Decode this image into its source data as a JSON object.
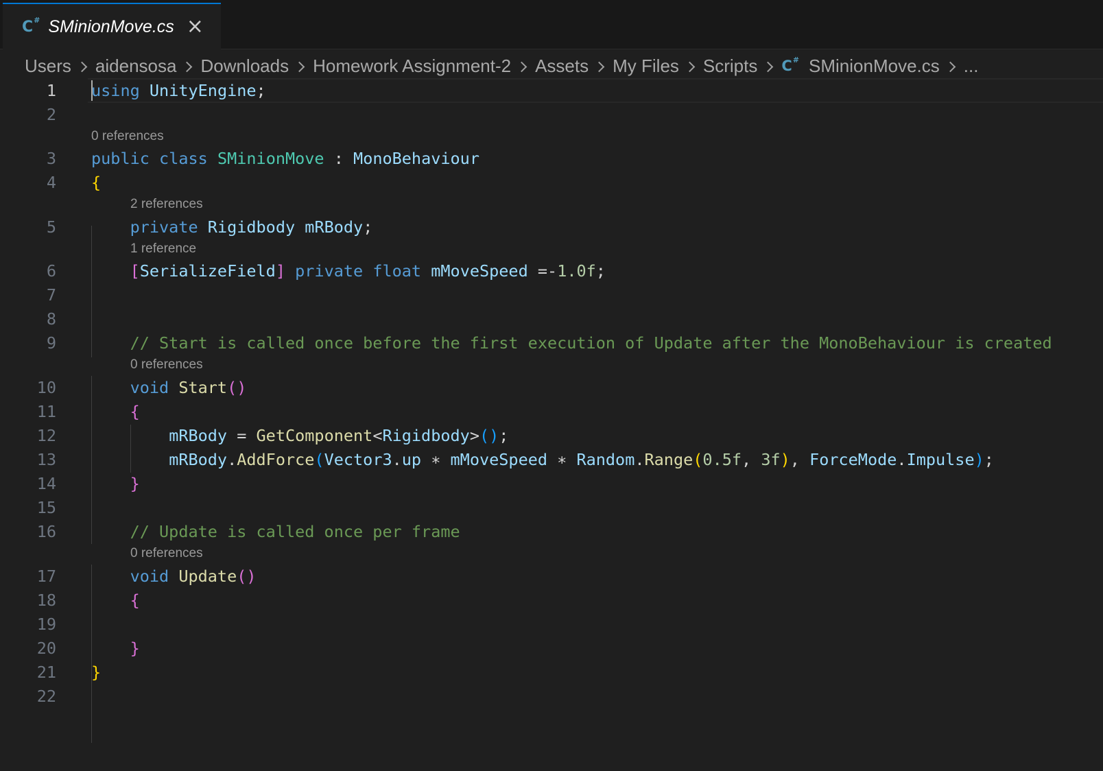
{
  "tab": {
    "icon": "csharp-file-icon",
    "name": "SMinionMove.cs",
    "close_glyph": "×"
  },
  "breadcrumb": {
    "items": [
      "Users",
      "aidensosa",
      "Downloads",
      "Homework Assignment-2",
      "Assets",
      "My Files",
      "Scripts"
    ],
    "file": "SMinionMove.cs",
    "more": "..."
  },
  "editor": {
    "active_line": 1,
    "code_lens": {
      "line3": "0 references",
      "line5": "2 references",
      "line6": "1 reference",
      "line10": "0 references",
      "line17": "0 references"
    },
    "lines": [
      {
        "number": "1",
        "tokens": [
          {
            "t": "using",
            "c": "kw"
          },
          {
            "t": " ",
            "c": "pl"
          },
          {
            "t": "UnityEngine",
            "c": "vr"
          },
          {
            "t": ";",
            "c": "pl"
          }
        ]
      },
      {
        "number": "2",
        "tokens": []
      },
      {
        "number": "3",
        "tokens": [
          {
            "t": "public",
            "c": "kw"
          },
          {
            "t": " ",
            "c": "pl"
          },
          {
            "t": "class",
            "c": "kw"
          },
          {
            "t": " ",
            "c": "pl"
          },
          {
            "t": "SMinionMove",
            "c": "ty"
          },
          {
            "t": " : ",
            "c": "pl"
          },
          {
            "t": "MonoBehaviour",
            "c": "vr"
          }
        ]
      },
      {
        "number": "4",
        "tokens": [
          {
            "t": "{",
            "c": "b1"
          }
        ]
      },
      {
        "number": "5",
        "tokens": [
          {
            "t": "    ",
            "c": "pl"
          },
          {
            "t": "private",
            "c": "kw"
          },
          {
            "t": " ",
            "c": "pl"
          },
          {
            "t": "Rigidbody",
            "c": "vr"
          },
          {
            "t": " ",
            "c": "pl"
          },
          {
            "t": "mRBody",
            "c": "vr"
          },
          {
            "t": ";",
            "c": "pl"
          }
        ]
      },
      {
        "number": "6",
        "tokens": [
          {
            "t": "    ",
            "c": "pl"
          },
          {
            "t": "[",
            "c": "b2"
          },
          {
            "t": "SerializeField",
            "c": "vr"
          },
          {
            "t": "]",
            "c": "b2"
          },
          {
            "t": " ",
            "c": "pl"
          },
          {
            "t": "private",
            "c": "kw"
          },
          {
            "t": " ",
            "c": "pl"
          },
          {
            "t": "float",
            "c": "kw"
          },
          {
            "t": " ",
            "c": "pl"
          },
          {
            "t": "mMoveSpeed",
            "c": "vr"
          },
          {
            "t": " =-",
            "c": "pl"
          },
          {
            "t": "1.0f",
            "c": "nm"
          },
          {
            "t": ";",
            "c": "pl"
          }
        ]
      },
      {
        "number": "7",
        "tokens": []
      },
      {
        "number": "8",
        "tokens": []
      },
      {
        "number": "9",
        "tokens": [
          {
            "t": "    ",
            "c": "pl"
          },
          {
            "t": "// Start is called once before the first execution of Update after the MonoBehaviour is created",
            "c": "cm"
          }
        ]
      },
      {
        "number": "10",
        "tokens": [
          {
            "t": "    ",
            "c": "pl"
          },
          {
            "t": "void",
            "c": "kw"
          },
          {
            "t": " ",
            "c": "pl"
          },
          {
            "t": "Start",
            "c": "fn"
          },
          {
            "t": "()",
            "c": "b2"
          }
        ]
      },
      {
        "number": "11",
        "tokens": [
          {
            "t": "    ",
            "c": "pl"
          },
          {
            "t": "{",
            "c": "b2"
          }
        ]
      },
      {
        "number": "12",
        "tokens": [
          {
            "t": "        ",
            "c": "pl"
          },
          {
            "t": "mRBody",
            "c": "vr"
          },
          {
            "t": " = ",
            "c": "pl"
          },
          {
            "t": "GetComponent",
            "c": "fn"
          },
          {
            "t": "<",
            "c": "pl"
          },
          {
            "t": "Rigidbody",
            "c": "vr"
          },
          {
            "t": ">",
            "c": "pl"
          },
          {
            "t": "()",
            "c": "b3"
          },
          {
            "t": ";",
            "c": "pl"
          }
        ]
      },
      {
        "number": "13",
        "tokens": [
          {
            "t": "        ",
            "c": "pl"
          },
          {
            "t": "mRBody",
            "c": "vr"
          },
          {
            "t": ".",
            "c": "pl"
          },
          {
            "t": "AddForce",
            "c": "fn"
          },
          {
            "t": "(",
            "c": "b3"
          },
          {
            "t": "Vector3",
            "c": "vr"
          },
          {
            "t": ".",
            "c": "pl"
          },
          {
            "t": "up",
            "c": "vr"
          },
          {
            "t": " ∗ ",
            "c": "pl"
          },
          {
            "t": "mMoveSpeed",
            "c": "vr"
          },
          {
            "t": " ∗ ",
            "c": "pl"
          },
          {
            "t": "Random",
            "c": "vr"
          },
          {
            "t": ".",
            "c": "pl"
          },
          {
            "t": "Range",
            "c": "fn"
          },
          {
            "t": "(",
            "c": "b1"
          },
          {
            "t": "0.5f",
            "c": "nm"
          },
          {
            "t": ", ",
            "c": "pl"
          },
          {
            "t": "3f",
            "c": "nm"
          },
          {
            "t": ")",
            "c": "b1"
          },
          {
            "t": ", ",
            "c": "pl"
          },
          {
            "t": "ForceMode",
            "c": "vr"
          },
          {
            "t": ".",
            "c": "pl"
          },
          {
            "t": "Impulse",
            "c": "vr"
          },
          {
            "t": ")",
            "c": "b3"
          },
          {
            "t": ";",
            "c": "pl"
          }
        ]
      },
      {
        "number": "14",
        "tokens": [
          {
            "t": "    ",
            "c": "pl"
          },
          {
            "t": "}",
            "c": "b2"
          }
        ]
      },
      {
        "number": "15",
        "tokens": []
      },
      {
        "number": "16",
        "tokens": [
          {
            "t": "    ",
            "c": "pl"
          },
          {
            "t": "// Update is called once per frame",
            "c": "cm"
          }
        ]
      },
      {
        "number": "17",
        "tokens": [
          {
            "t": "    ",
            "c": "pl"
          },
          {
            "t": "void",
            "c": "kw"
          },
          {
            "t": " ",
            "c": "pl"
          },
          {
            "t": "Update",
            "c": "fn"
          },
          {
            "t": "()",
            "c": "b2"
          }
        ]
      },
      {
        "number": "18",
        "tokens": [
          {
            "t": "    ",
            "c": "pl"
          },
          {
            "t": "{",
            "c": "b2"
          }
        ]
      },
      {
        "number": "19",
        "tokens": []
      },
      {
        "number": "20",
        "tokens": [
          {
            "t": "    ",
            "c": "pl"
          },
          {
            "t": "}",
            "c": "b2"
          }
        ]
      },
      {
        "number": "21",
        "tokens": [
          {
            "t": "}",
            "c": "b1"
          }
        ]
      },
      {
        "number": "22",
        "tokens": []
      }
    ]
  }
}
